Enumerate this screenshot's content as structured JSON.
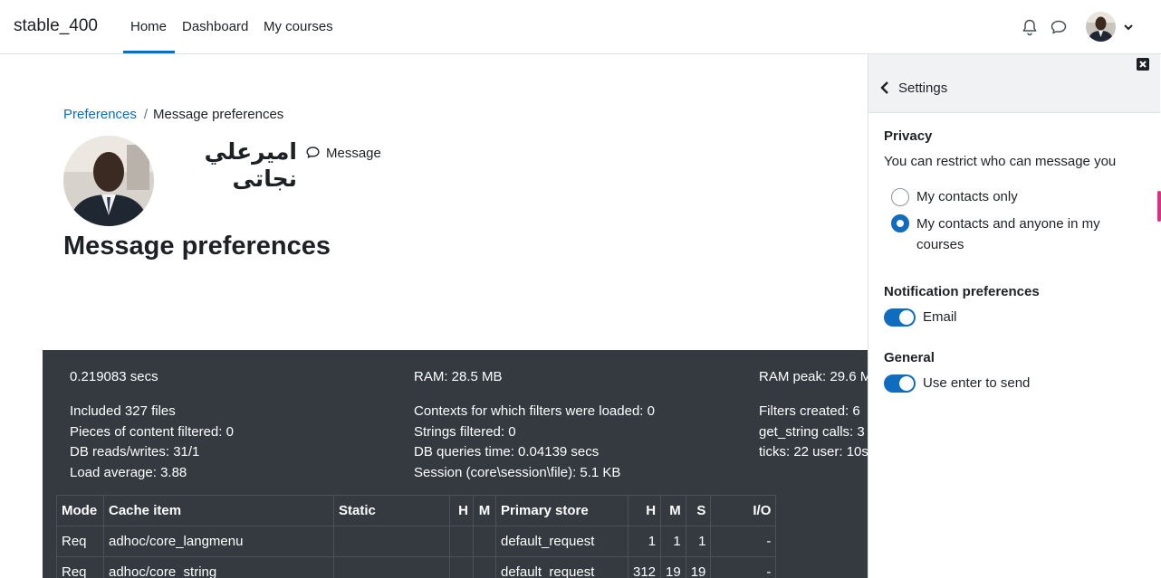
{
  "navbar": {
    "brand": "stable_400",
    "links": {
      "home": "Home",
      "dashboard": "Dashboard",
      "my_courses": "My courses"
    },
    "icons": {
      "notifications": "bell-icon",
      "messages": "chat-bubble-icon",
      "user_menu": "chevron-down-icon"
    },
    "accent": "#0f6cbf"
  },
  "breadcrumb": {
    "link": "Preferences",
    "separator": "/",
    "current": "Message preferences"
  },
  "profile": {
    "name": "امیرعلي نجاتی",
    "message_label": "Message"
  },
  "page_title": "Message preferences",
  "perf": {
    "col1": {
      "time": "0.219083 secs",
      "files": "Included 327 files",
      "filtered": "Pieces of content filtered: 0",
      "db": "DB reads/writes: 31/1",
      "load": "Load average: 3.88"
    },
    "col2": {
      "ram": "RAM: 28.5 MB",
      "contexts": "Contexts for which filters were loaded: 0",
      "strings": "Strings filtered: 0",
      "dbtime": "DB queries time: 0.04139 secs",
      "session": "Session (core\\session\\file): 5.1 KB"
    },
    "col3": {
      "ram_peak": "RAM peak: 29.6 M",
      "filters": "Filters created: 6",
      "get_string": "get_string calls: 3",
      "ticks": "ticks: 22 user: 10s"
    },
    "table": {
      "headers": [
        "Mode",
        "Cache item",
        "Static",
        "H",
        "M",
        "Primary store",
        "H",
        "M",
        "S",
        "I/O"
      ],
      "rows": [
        [
          "Req",
          "adhoc/core_langmenu",
          "",
          "",
          "",
          "default_request",
          "1",
          "1",
          "1",
          "-"
        ],
        [
          "Req",
          "adhoc/core_string",
          "",
          "",
          "",
          "default_request",
          "312",
          "19",
          "19",
          "-"
        ]
      ]
    }
  },
  "drawer": {
    "title": "Settings",
    "privacy": {
      "heading": "Privacy",
      "description": "You can restrict who can message you",
      "options": [
        "My contacts only",
        "My contacts and anyone in my courses"
      ],
      "selected_index": 1
    },
    "notifications": {
      "heading": "Notification preferences",
      "email_label": "Email",
      "email_on": true
    },
    "general": {
      "heading": "General",
      "enter_label": "Use enter to send",
      "enter_on": true
    }
  }
}
